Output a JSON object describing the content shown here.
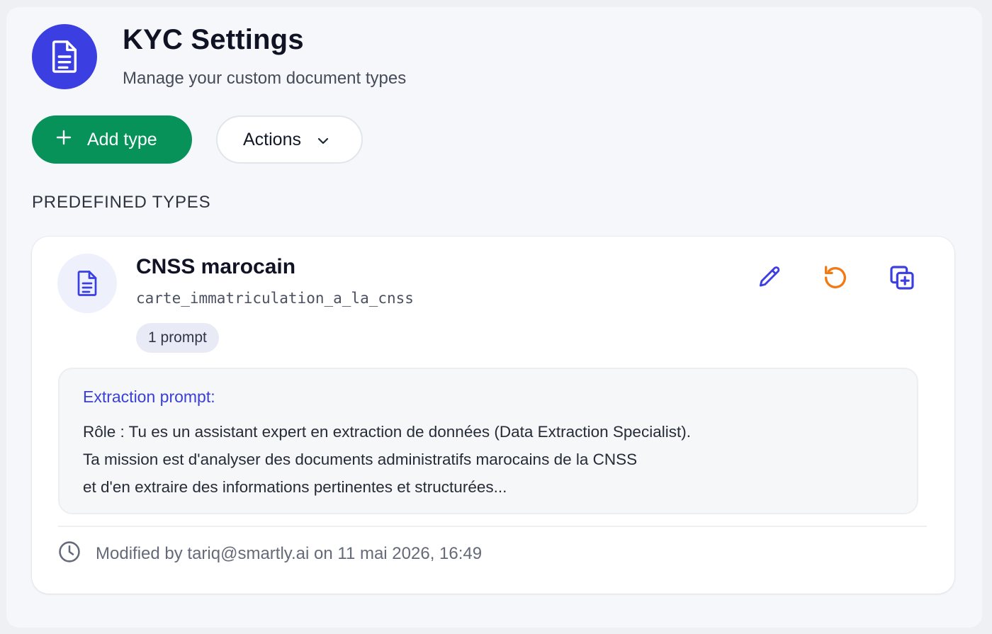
{
  "header": {
    "icon": "document-icon",
    "title": "KYC Settings",
    "subtitle": "Manage your custom document types"
  },
  "toolbar": {
    "add_label": "Add type",
    "actions_label": "Actions"
  },
  "section": {
    "title": "PREDEFINED TYPES"
  },
  "card": {
    "icon": "document-icon",
    "title": "CNSS marocain",
    "code": "carte_immatriculation_a_la_cnss",
    "badge": "1 prompt",
    "actions": [
      {
        "name": "edit-icon",
        "color": "#3b3fe2"
      },
      {
        "name": "reset-icon",
        "color": "#f07b16"
      },
      {
        "name": "duplicate-icon",
        "color": "#3b3fe2"
      }
    ],
    "prompt": {
      "label": "Extraction prompt:",
      "lines": [
        "Rôle : Tu es un assistant expert en extraction de données (Data Extraction Specialist).",
        "Ta mission est d'analyser des documents administratifs marocains de la CNSS",
        "et d'en extraire des informations pertinentes et structurées..."
      ]
    },
    "footer": "Modified by tariq@smartly.ai on 11 mai 2026, 16:49"
  },
  "colors": {
    "primary": "#3b3fe2",
    "success": "#07925a",
    "warning": "#f07b16"
  }
}
